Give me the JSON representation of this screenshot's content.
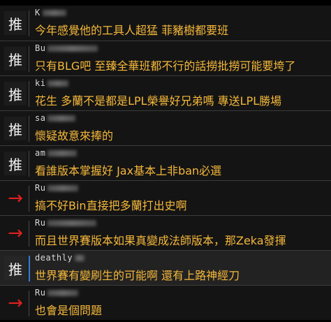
{
  "comments": [
    {
      "tag": "推",
      "tag_type": "push",
      "user": "K",
      "content": "今年感覺他的工具人超猛 菲豬樹都要班"
    },
    {
      "tag": "推",
      "tag_type": "push",
      "user": "Bu",
      "content": "只有BLG吧 至臻全華班都不行的話撈批撈可能要垮了"
    },
    {
      "tag": "推",
      "tag_type": "push",
      "user": "ki",
      "content": "花生 多蘭不是都是LPL榮譽好兄弟嗎 專送LPL勝場"
    },
    {
      "tag": "推",
      "tag_type": "push",
      "user": "sa",
      "content": "懷疑故意來捧的"
    },
    {
      "tag": "推",
      "tag_type": "push",
      "user": "am",
      "content": "看誰版本掌握好 Jax基本上非ban必選"
    },
    {
      "tag": "→",
      "tag_type": "arrow",
      "user": "Ru",
      "content": "搞不好Bin直接把多蘭打出史啊"
    },
    {
      "tag": "→",
      "tag_type": "arrow",
      "user": "Ru",
      "content": "而且世界賽版本如果真變成法師版本，那Zeka發揮"
    },
    {
      "tag": "推",
      "tag_type": "push",
      "user": "deathly",
      "content": "世界賽有變刷生的可能啊 還有上路神經刀"
    },
    {
      "tag": "→",
      "tag_type": "arrow",
      "user": "Ru",
      "content": "也會是個問題"
    }
  ],
  "colors": {
    "push": "#f0f0f0",
    "arrow": "#e02020",
    "content": "#f5b83a",
    "highlight_bar": "#2f7fd8"
  }
}
